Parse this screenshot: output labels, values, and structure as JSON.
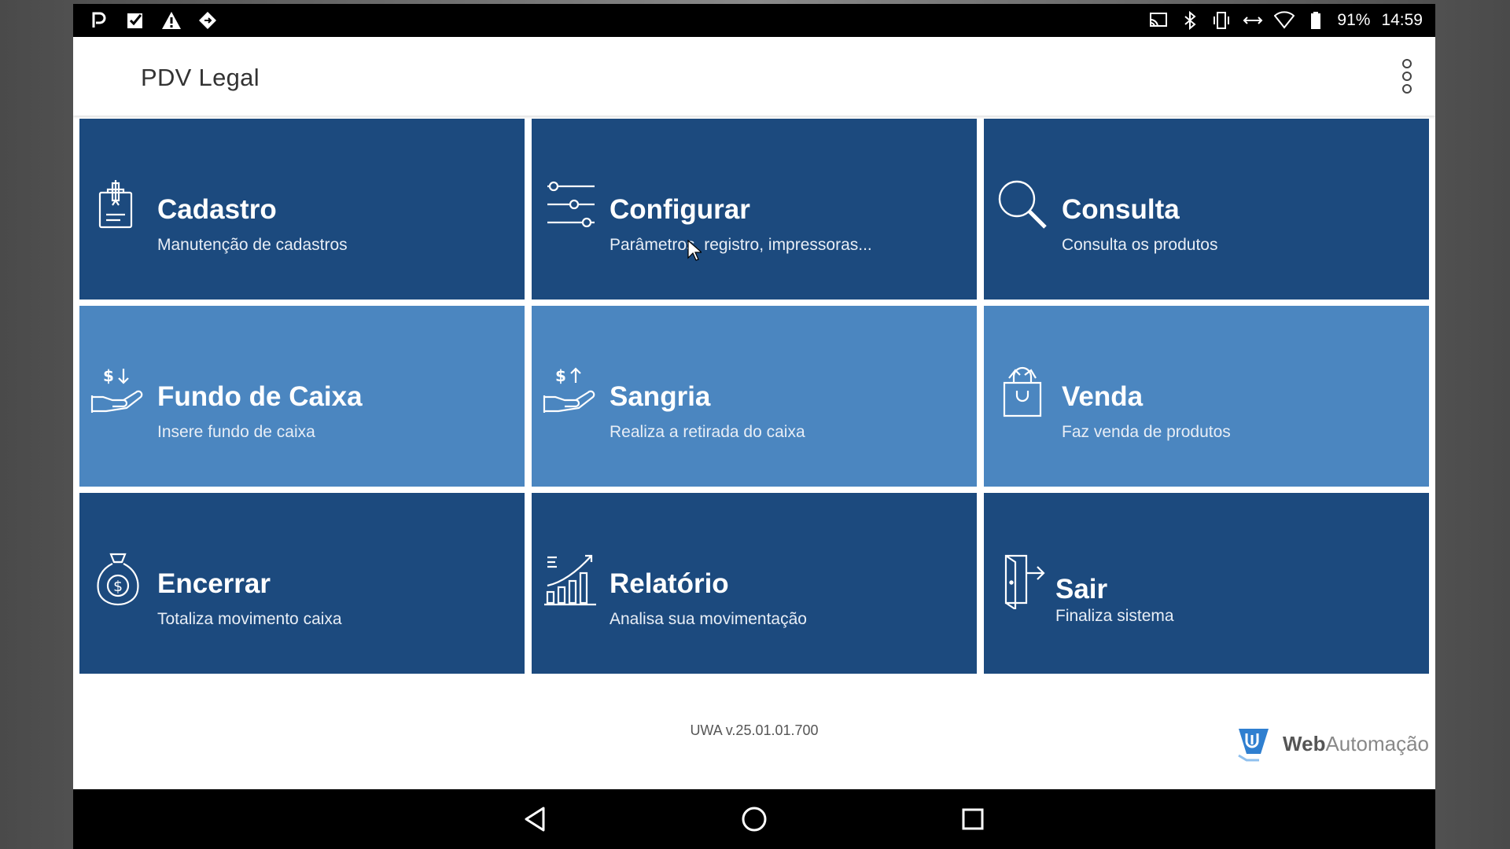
{
  "status_bar": {
    "left_icons": [
      "p-notification-icon",
      "checkbox-notification-icon",
      "warning-icon",
      "diamond-arrows-icon"
    ],
    "right_icons": [
      "cast-icon",
      "bluetooth-icon",
      "vibrate-icon",
      "data-arrows-icon",
      "wifi-icon",
      "battery-icon"
    ],
    "battery": "91%",
    "time": "14:59"
  },
  "app_bar": {
    "title": "PDV Legal",
    "menu_icon": "more-vert-icon"
  },
  "tiles": [
    {
      "title": "Cadastro",
      "subtitle": "Manutenção de cadastros",
      "icon": "clipboard-pen-icon",
      "color": "#1c4a7e"
    },
    {
      "title": "Configurar",
      "subtitle": "Parâmetros, registro, impressoras...",
      "icon": "sliders-icon",
      "color": "#1c4a7e"
    },
    {
      "title": "Consulta",
      "subtitle": "Consulta os produtos",
      "icon": "search-icon",
      "color": "#1c4a7e"
    },
    {
      "title": "Fundo de Caixa",
      "subtitle": "Insere fundo de caixa",
      "icon": "money-in-hand-icon",
      "color": "#4b86c0"
    },
    {
      "title": "Sangria",
      "subtitle": "Realiza a retirada do caixa",
      "icon": "money-out-hand-icon",
      "color": "#4b86c0"
    },
    {
      "title": "Venda",
      "subtitle": "Faz venda de produtos",
      "icon": "shopping-bag-icon",
      "color": "#4b86c0"
    },
    {
      "title": "Encerrar",
      "subtitle": "Totaliza movimento caixa",
      "icon": "money-bag-icon",
      "color": "#1c4a7e"
    },
    {
      "title": "Relatório",
      "subtitle": "Analisa sua movimentação",
      "icon": "bar-chart-icon",
      "color": "#1c4a7e"
    },
    {
      "title": "Sair",
      "subtitle": "Finaliza sistema",
      "icon": "exit-door-icon",
      "color": "#1c4a7e"
    }
  ],
  "footer": {
    "version": "UWA v.25.01.01.700",
    "brand_bold": "Web",
    "brand_light": "Automação",
    "brand_color": "#2f7fd0"
  },
  "nav_bar": {
    "buttons": [
      "back-icon",
      "home-icon",
      "recents-icon"
    ]
  }
}
